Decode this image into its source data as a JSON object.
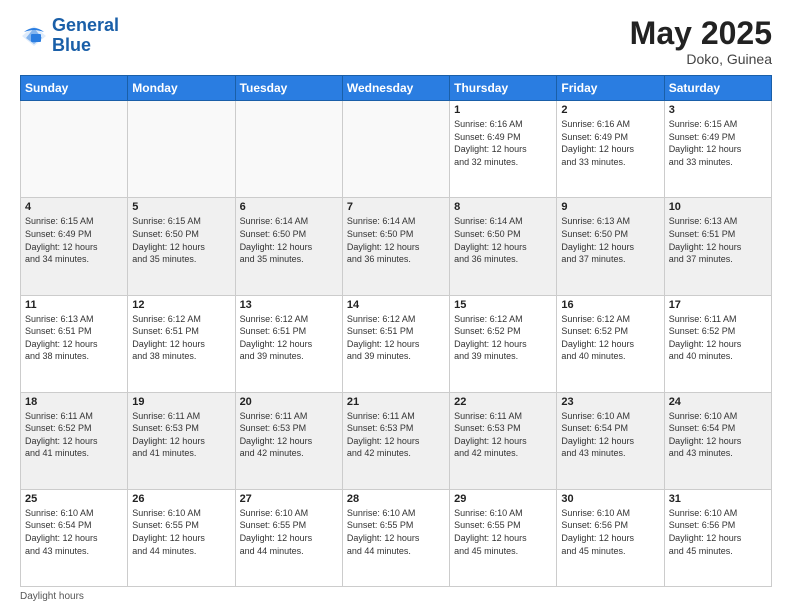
{
  "header": {
    "logo_line1": "General",
    "logo_line2": "Blue",
    "month_title": "May 2025",
    "location": "Doko, Guinea"
  },
  "footer": {
    "note": "Daylight hours"
  },
  "days_of_week": [
    "Sunday",
    "Monday",
    "Tuesday",
    "Wednesday",
    "Thursday",
    "Friday",
    "Saturday"
  ],
  "weeks": [
    [
      {
        "day": "",
        "info": "",
        "empty": true
      },
      {
        "day": "",
        "info": "",
        "empty": true
      },
      {
        "day": "",
        "info": "",
        "empty": true
      },
      {
        "day": "",
        "info": "",
        "empty": true
      },
      {
        "day": "1",
        "info": "Sunrise: 6:16 AM\nSunset: 6:49 PM\nDaylight: 12 hours\nand 32 minutes.",
        "empty": false
      },
      {
        "day": "2",
        "info": "Sunrise: 6:16 AM\nSunset: 6:49 PM\nDaylight: 12 hours\nand 33 minutes.",
        "empty": false
      },
      {
        "day": "3",
        "info": "Sunrise: 6:15 AM\nSunset: 6:49 PM\nDaylight: 12 hours\nand 33 minutes.",
        "empty": false
      }
    ],
    [
      {
        "day": "4",
        "info": "Sunrise: 6:15 AM\nSunset: 6:49 PM\nDaylight: 12 hours\nand 34 minutes.",
        "empty": false
      },
      {
        "day": "5",
        "info": "Sunrise: 6:15 AM\nSunset: 6:50 PM\nDaylight: 12 hours\nand 35 minutes.",
        "empty": false
      },
      {
        "day": "6",
        "info": "Sunrise: 6:14 AM\nSunset: 6:50 PM\nDaylight: 12 hours\nand 35 minutes.",
        "empty": false
      },
      {
        "day": "7",
        "info": "Sunrise: 6:14 AM\nSunset: 6:50 PM\nDaylight: 12 hours\nand 36 minutes.",
        "empty": false
      },
      {
        "day": "8",
        "info": "Sunrise: 6:14 AM\nSunset: 6:50 PM\nDaylight: 12 hours\nand 36 minutes.",
        "empty": false
      },
      {
        "day": "9",
        "info": "Sunrise: 6:13 AM\nSunset: 6:50 PM\nDaylight: 12 hours\nand 37 minutes.",
        "empty": false
      },
      {
        "day": "10",
        "info": "Sunrise: 6:13 AM\nSunset: 6:51 PM\nDaylight: 12 hours\nand 37 minutes.",
        "empty": false
      }
    ],
    [
      {
        "day": "11",
        "info": "Sunrise: 6:13 AM\nSunset: 6:51 PM\nDaylight: 12 hours\nand 38 minutes.",
        "empty": false
      },
      {
        "day": "12",
        "info": "Sunrise: 6:12 AM\nSunset: 6:51 PM\nDaylight: 12 hours\nand 38 minutes.",
        "empty": false
      },
      {
        "day": "13",
        "info": "Sunrise: 6:12 AM\nSunset: 6:51 PM\nDaylight: 12 hours\nand 39 minutes.",
        "empty": false
      },
      {
        "day": "14",
        "info": "Sunrise: 6:12 AM\nSunset: 6:51 PM\nDaylight: 12 hours\nand 39 minutes.",
        "empty": false
      },
      {
        "day": "15",
        "info": "Sunrise: 6:12 AM\nSunset: 6:52 PM\nDaylight: 12 hours\nand 39 minutes.",
        "empty": false
      },
      {
        "day": "16",
        "info": "Sunrise: 6:12 AM\nSunset: 6:52 PM\nDaylight: 12 hours\nand 40 minutes.",
        "empty": false
      },
      {
        "day": "17",
        "info": "Sunrise: 6:11 AM\nSunset: 6:52 PM\nDaylight: 12 hours\nand 40 minutes.",
        "empty": false
      }
    ],
    [
      {
        "day": "18",
        "info": "Sunrise: 6:11 AM\nSunset: 6:52 PM\nDaylight: 12 hours\nand 41 minutes.",
        "empty": false
      },
      {
        "day": "19",
        "info": "Sunrise: 6:11 AM\nSunset: 6:53 PM\nDaylight: 12 hours\nand 41 minutes.",
        "empty": false
      },
      {
        "day": "20",
        "info": "Sunrise: 6:11 AM\nSunset: 6:53 PM\nDaylight: 12 hours\nand 42 minutes.",
        "empty": false
      },
      {
        "day": "21",
        "info": "Sunrise: 6:11 AM\nSunset: 6:53 PM\nDaylight: 12 hours\nand 42 minutes.",
        "empty": false
      },
      {
        "day": "22",
        "info": "Sunrise: 6:11 AM\nSunset: 6:53 PM\nDaylight: 12 hours\nand 42 minutes.",
        "empty": false
      },
      {
        "day": "23",
        "info": "Sunrise: 6:10 AM\nSunset: 6:54 PM\nDaylight: 12 hours\nand 43 minutes.",
        "empty": false
      },
      {
        "day": "24",
        "info": "Sunrise: 6:10 AM\nSunset: 6:54 PM\nDaylight: 12 hours\nand 43 minutes.",
        "empty": false
      }
    ],
    [
      {
        "day": "25",
        "info": "Sunrise: 6:10 AM\nSunset: 6:54 PM\nDaylight: 12 hours\nand 43 minutes.",
        "empty": false
      },
      {
        "day": "26",
        "info": "Sunrise: 6:10 AM\nSunset: 6:55 PM\nDaylight: 12 hours\nand 44 minutes.",
        "empty": false
      },
      {
        "day": "27",
        "info": "Sunrise: 6:10 AM\nSunset: 6:55 PM\nDaylight: 12 hours\nand 44 minutes.",
        "empty": false
      },
      {
        "day": "28",
        "info": "Sunrise: 6:10 AM\nSunset: 6:55 PM\nDaylight: 12 hours\nand 44 minutes.",
        "empty": false
      },
      {
        "day": "29",
        "info": "Sunrise: 6:10 AM\nSunset: 6:55 PM\nDaylight: 12 hours\nand 45 minutes.",
        "empty": false
      },
      {
        "day": "30",
        "info": "Sunrise: 6:10 AM\nSunset: 6:56 PM\nDaylight: 12 hours\nand 45 minutes.",
        "empty": false
      },
      {
        "day": "31",
        "info": "Sunrise: 6:10 AM\nSunset: 6:56 PM\nDaylight: 12 hours\nand 45 minutes.",
        "empty": false
      }
    ]
  ]
}
